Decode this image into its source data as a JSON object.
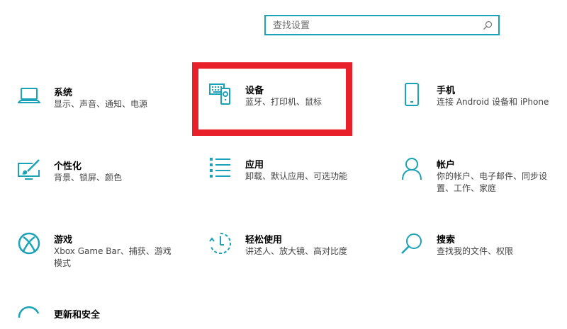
{
  "search": {
    "placeholder": "查找设置"
  },
  "tiles": [
    {
      "title": "系统",
      "desc": "显示、声音、通知、电源",
      "icon": "laptop-icon"
    },
    {
      "title": "设备",
      "desc": "蓝牙、打印机、鼠标",
      "icon": "devices-icon"
    },
    {
      "title": "手机",
      "desc": "连接 Android 设备和 iPhone",
      "icon": "phone-icon"
    },
    {
      "title": "个性化",
      "desc": "背景、锁屏、颜色",
      "icon": "personalization-icon"
    },
    {
      "title": "应用",
      "desc": "卸载、默认应用、可选功能",
      "icon": "apps-icon"
    },
    {
      "title": "帐户",
      "desc": "你的帐户、电子邮件、同步设置、工作、家庭",
      "icon": "account-icon"
    },
    {
      "title": "游戏",
      "desc": "Xbox Game Bar、捕获、游戏模式",
      "icon": "xbox-icon"
    },
    {
      "title": "轻松使用",
      "desc": "讲述人、放大镜、高对比度",
      "icon": "ease-of-access-icon"
    },
    {
      "title": "搜索",
      "desc": "查找我的文件、权限",
      "icon": "search-icon"
    },
    {
      "title": "更新和安全",
      "desc": "",
      "icon": "update-icon"
    }
  ],
  "colors": {
    "accent": "#1aa3b8",
    "highlight": "#e8202a"
  }
}
